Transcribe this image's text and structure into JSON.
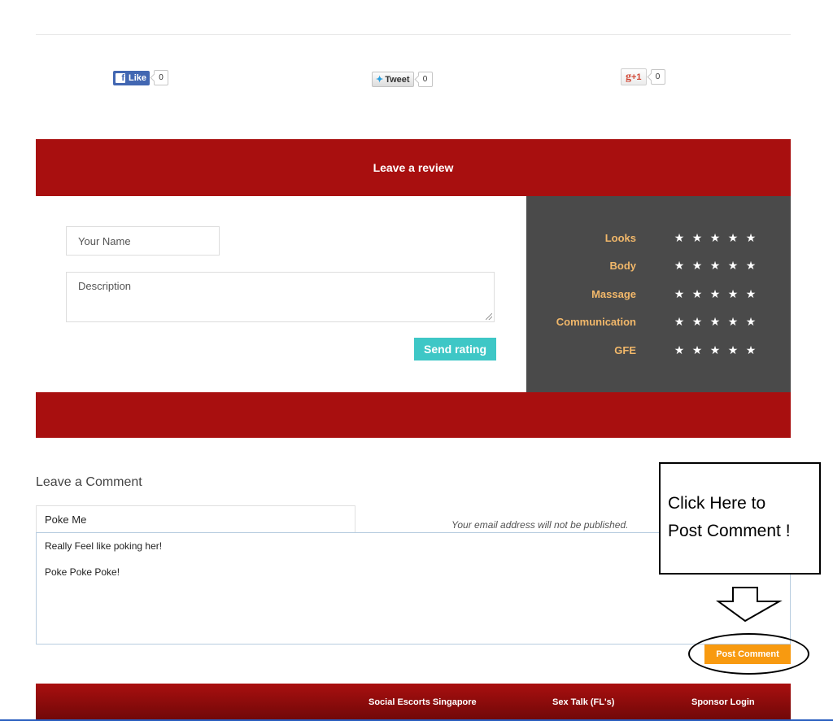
{
  "share": {
    "facebook": {
      "label": "Like",
      "count": "0"
    },
    "twitter": {
      "label": "Tweet",
      "count": "0"
    },
    "google": {
      "label": "+1",
      "count": "0"
    }
  },
  "review": {
    "title": "Leave a review",
    "name_placeholder": "Your Name",
    "description_placeholder": "Description",
    "send_label": "Send rating",
    "ratings": [
      {
        "label": "Looks",
        "stars": 5
      },
      {
        "label": "Body",
        "stars": 5
      },
      {
        "label": "Massage",
        "stars": 5
      },
      {
        "label": "Communication",
        "stars": 5
      },
      {
        "label": "GFE",
        "stars": 5
      }
    ]
  },
  "comment": {
    "title": "Leave a Comment",
    "name_value": "Poke Me",
    "email_note": "Your email address will not be published.",
    "text_line1": "Really Feel like poking her!",
    "text_line2": "Poke Poke Poke!",
    "post_label": "Post Comment"
  },
  "annotation": {
    "line1": "Click Here to",
    "line2": "Post Comment !"
  },
  "footer": {
    "links": [
      "Social Escorts Singapore",
      "Sex Talk (FL's)",
      "Sponsor Login"
    ]
  },
  "colors": {
    "brand_red": "#a80f0f",
    "panel_dark": "#4a4a4a",
    "teal_button": "#3ec7c6",
    "orange_button": "#f89a10",
    "rating_label": "#f2b86a"
  }
}
